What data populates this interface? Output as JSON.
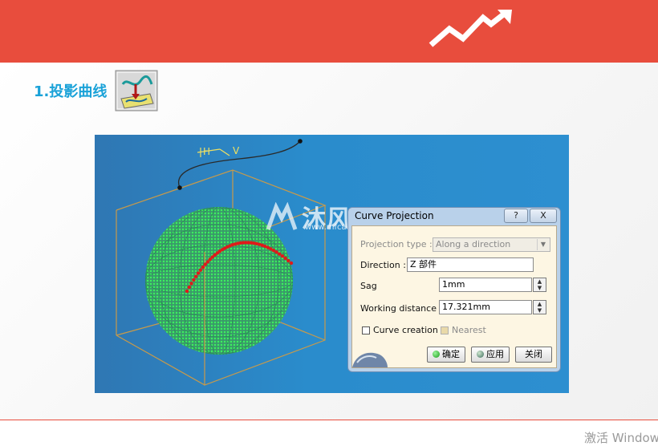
{
  "colors": {
    "header": "#e84d3d",
    "heading": "#1aa2d8",
    "viewport": "#2a8ccc",
    "sphere": "#22dd55",
    "curve": "#e01a1a",
    "box": "#c89a4a"
  },
  "icons": {
    "header_icon": "trend-up-arrow-icon",
    "tool_icon": "project-curve-tool-icon"
  },
  "slide": {
    "heading": "1.投影曲线"
  },
  "viewport": {
    "labels": {
      "h": "H",
      "v": "V"
    },
    "watermark": {
      "text": "沐风网",
      "url": "www.mfcad.com"
    }
  },
  "dialog": {
    "title": "Curve Projection",
    "help_label": "?",
    "close_label": "X",
    "projection_type_label": "Projection type :",
    "projection_type_value": "Along a direction",
    "direction_label": "Direction :",
    "direction_value": "Z 部件",
    "sag_label": "Sag",
    "sag_value": "1mm",
    "working_distance_label": "Working distance",
    "working_distance_value": "17.321mm",
    "curve_creation_label": "Curve creation",
    "nearest_label": "Nearest",
    "ok_label": "确定",
    "apply_label": "应用",
    "cancel_label": "关闭"
  },
  "taskbar_text": "激活 Window"
}
